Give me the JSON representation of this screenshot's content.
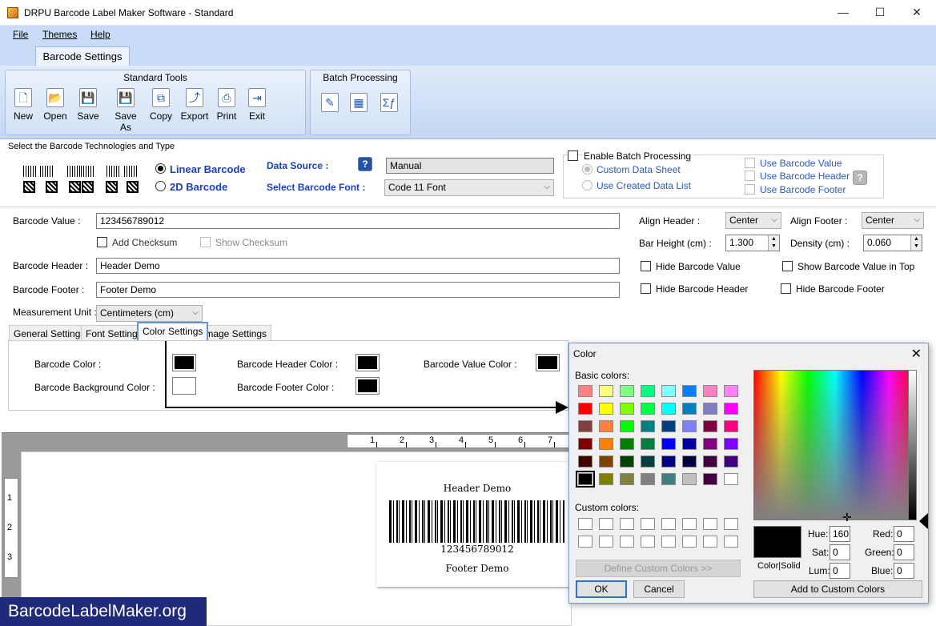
{
  "window": {
    "title": "DRPU Barcode Label Maker Software - Standard",
    "minimize": "—",
    "maximize": "☐",
    "close": "✕"
  },
  "menu": [
    "File",
    "Themes",
    "Help"
  ],
  "ribbon": {
    "tab": "Barcode Settings",
    "standard_tools": {
      "label": "Standard Tools",
      "tools": [
        {
          "label": "New",
          "icon": "new-document-icon",
          "glyph": "🗋"
        },
        {
          "label": "Open",
          "icon": "open-folder-icon",
          "glyph": "📂"
        },
        {
          "label": "Save",
          "icon": "save-icon",
          "glyph": "💾"
        },
        {
          "label": "Save As",
          "icon": "save-as-icon",
          "glyph": "💾"
        },
        {
          "label": "Copy",
          "icon": "copy-icon",
          "glyph": "⧉"
        },
        {
          "label": "Export",
          "icon": "export-icon",
          "glyph": "⤴"
        },
        {
          "label": "Print",
          "icon": "print-icon",
          "glyph": "⎙"
        },
        {
          "label": "Exit",
          "icon": "exit-icon",
          "glyph": "⇥"
        }
      ]
    },
    "batch": {
      "label": "Batch Processing",
      "tools": [
        {
          "icon": "edit-batch-icon",
          "glyph": "✎"
        },
        {
          "icon": "excel-import-icon",
          "glyph": "▦"
        },
        {
          "icon": "formula-icon",
          "glyph": "Σƒ"
        }
      ]
    }
  },
  "tech": {
    "label": "Select the Barcode Technologies and Type",
    "linear": "Linear Barcode",
    "twod": "2D Barcode",
    "data_source_label": "Data Source :",
    "data_source_value": "Manual",
    "font_label": "Select Barcode Font :",
    "font_value": "Code 11 Font",
    "help": "?"
  },
  "batch": {
    "enable": "Enable Batch Processing",
    "custom_sheet": "Custom Data Sheet",
    "created_list": "Use Created Data List",
    "use_value": "Use Barcode Value",
    "use_header": "Use Barcode Header",
    "use_footer": "Use Barcode Footer",
    "help": "?"
  },
  "form": {
    "value_label": "Barcode Value :",
    "value": "123456789012",
    "add_checksum": "Add Checksum",
    "show_checksum": "Show Checksum",
    "header_label": "Barcode Header :",
    "header": "Header Demo",
    "footer_label": "Barcode Footer :",
    "footer": "Footer Demo",
    "unit_label": "Measurement Unit :",
    "unit": "Centimeters (cm)",
    "align_header_label": "Align Header :",
    "align_header": "Center",
    "align_footer_label": "Align Footer :",
    "align_footer": "Center",
    "bar_height_label": "Bar Height (cm) :",
    "bar_height": "1.300",
    "density_label": "Density (cm) :",
    "density": "0.060",
    "hide_value": "Hide Barcode Value",
    "show_value_top": "Show Barcode Value in Top",
    "hide_header": "Hide Barcode Header",
    "hide_footer": "Hide Barcode Footer"
  },
  "tabs": [
    "General Settings",
    "Font Settings",
    "Color Settings",
    "Image Settings"
  ],
  "color_settings": {
    "barcode_color": "Barcode Color :",
    "bg_color": "Barcode Background Color :",
    "header_color": "Barcode Header Color :",
    "footer_color": "Barcode Footer Color :",
    "value_color": "Barcode Value Color :",
    "colors": {
      "barcode": "#000000",
      "bg": "#ffffff",
      "header": "#000000",
      "footer": "#000000",
      "value": "#000000"
    }
  },
  "preview": {
    "header": "Header Demo",
    "value": "123456789012",
    "footer": "Footer Demo",
    "ruler_h": [
      "1",
      "2",
      "3",
      "4",
      "5",
      "6",
      "7"
    ],
    "ruler_v": [
      "1",
      "2",
      "3"
    ]
  },
  "dialog": {
    "title": "Color",
    "close": "✕",
    "basic_label": "Basic colors:",
    "custom_label": "Custom colors:",
    "define_custom": "Define Custom Colors >>",
    "ok": "OK",
    "cancel": "Cancel",
    "add_custom": "Add to Custom Colors",
    "color_solid": "Color|Solid",
    "hue_label": "Hue:",
    "hue": "160",
    "sat_label": "Sat:",
    "sat": "0",
    "lum_label": "Lum:",
    "lum": "0",
    "red_label": "Red:",
    "red": "0",
    "green_label": "Green:",
    "green": "0",
    "blue_label": "Blue:",
    "blue": "0",
    "basic_colors": [
      [
        "#ff8080",
        "#ffff80",
        "#80ff80",
        "#00ff80",
        "#80ffff",
        "#0080ff",
        "#ff80c0",
        "#ff80ff"
      ],
      [
        "#ff0000",
        "#ffff00",
        "#80ff00",
        "#00ff40",
        "#00ffff",
        "#0080c0",
        "#8080c0",
        "#ff00ff"
      ],
      [
        "#804040",
        "#ff8040",
        "#00ff00",
        "#008080",
        "#004080",
        "#8080ff",
        "#800040",
        "#ff0080"
      ],
      [
        "#800000",
        "#ff8000",
        "#008000",
        "#008040",
        "#0000ff",
        "#0000a0",
        "#800080",
        "#8000ff"
      ],
      [
        "#400000",
        "#804000",
        "#004000",
        "#004040",
        "#000080",
        "#000040",
        "#400040",
        "#400080"
      ],
      [
        "#000000",
        "#808000",
        "#808040",
        "#808080",
        "#408080",
        "#c0c0c0",
        "#400040",
        "#ffffff"
      ]
    ]
  },
  "watermark": "BarcodeLabelMaker.org"
}
